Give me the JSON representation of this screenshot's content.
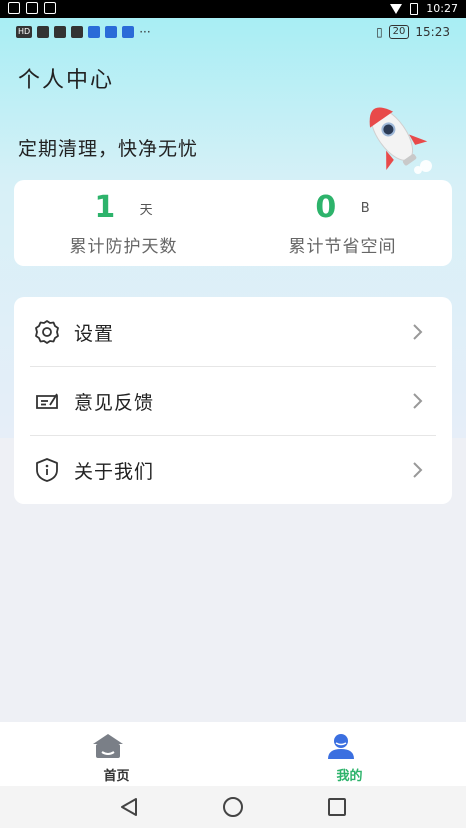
{
  "system_status": {
    "time": "10:27"
  },
  "app_status": {
    "left_badges": [
      "HD"
    ],
    "battery": "20",
    "time": "15:23",
    "more": "···"
  },
  "header": {
    "title": "个人中心",
    "slogan": "定期清理，快净无忧"
  },
  "stats": [
    {
      "value": "1",
      "unit": "天",
      "label": "累计防护天数"
    },
    {
      "value": "0",
      "unit": "B",
      "label": "累计节省空间"
    }
  ],
  "menu": {
    "items": [
      {
        "label": "设置",
        "icon": "gear-icon"
      },
      {
        "label": "意见反馈",
        "icon": "feedback-icon"
      },
      {
        "label": "关于我们",
        "icon": "info-shield-icon"
      }
    ]
  },
  "bottom_nav": {
    "tabs": [
      {
        "label": "首页",
        "icon": "home-icon",
        "active": false
      },
      {
        "label": "我的",
        "icon": "profile-icon",
        "active": true
      }
    ]
  },
  "colors": {
    "accent": "#2db36b",
    "card": "#ffffff",
    "gradient_top": "#a8eef4"
  }
}
